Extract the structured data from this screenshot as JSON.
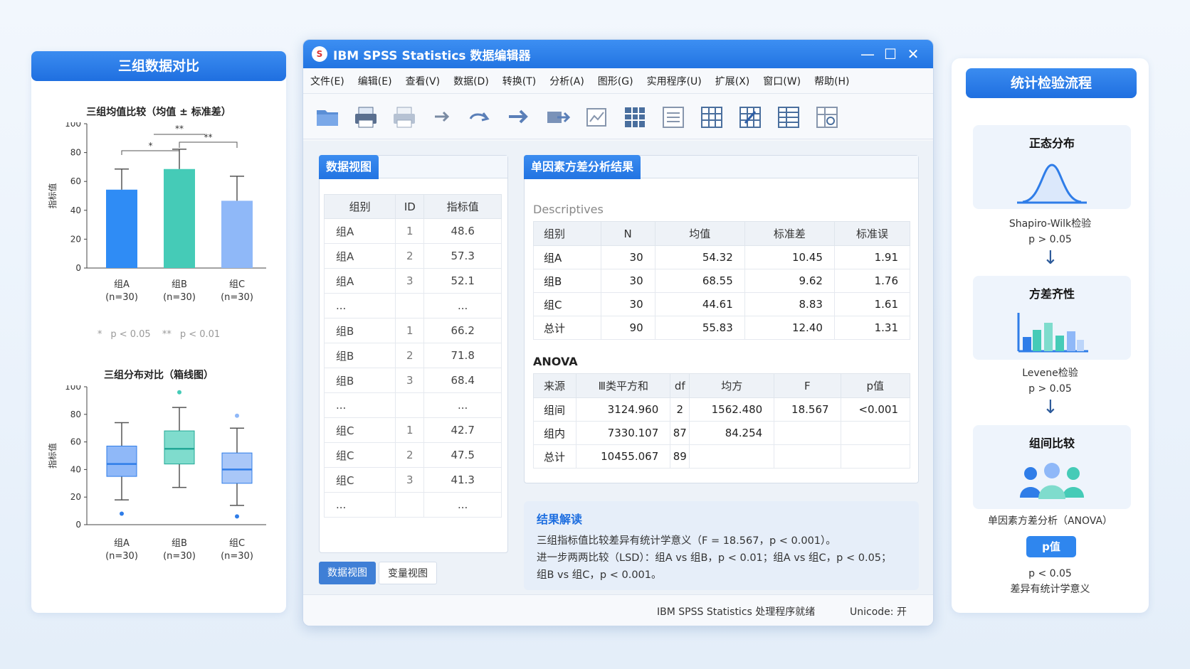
{
  "left_panel": {
    "header": "三组数据对比",
    "bar_chart_title": "三组均值比较（均值 ± 标准差）",
    "box_chart_title": "三组分布对比（箱线图）",
    "legend_single_star": "*",
    "legend_single_label": "p < 0.05",
    "legend_double_star": "**",
    "legend_double_label": "p < 0.01"
  },
  "chart_data": [
    {
      "type": "bar",
      "title": "三组均值比较（均值 ± 标准差）",
      "ylabel": "指标值",
      "ylim": [
        0,
        100
      ],
      "yticks": [
        0,
        20,
        40,
        60,
        80,
        100
      ],
      "categories": [
        "组A",
        "组B",
        "组C"
      ],
      "category_sub": [
        "(n=30)",
        "(n=30)",
        "(n=30)"
      ],
      "values": [
        54.3,
        68.6,
        46.6
      ],
      "errors": [
        14.3,
        13.7,
        17.0
      ],
      "colors": [
        "#2f8cf5",
        "#45cbb7",
        "#8fb8f8"
      ],
      "significance": [
        {
          "from": 0,
          "to": 1,
          "label": "*"
        },
        {
          "from": 1,
          "to": 2,
          "label": "**"
        },
        {
          "from": 1,
          "to": 1,
          "label": "**"
        }
      ]
    },
    {
      "type": "box",
      "title": "三组分布对比（箱线图）",
      "ylabel": "指标值",
      "ylim": [
        0,
        100
      ],
      "yticks": [
        0,
        20,
        40,
        60,
        80,
        100
      ],
      "categories": [
        "组A",
        "组B",
        "组C"
      ],
      "category_sub": [
        "(n=30)",
        "(n=30)",
        "(n=30)"
      ],
      "boxes": [
        {
          "min": 18,
          "q1": 35,
          "median": 44,
          "q3": 57,
          "max": 74,
          "outliers": [
            8
          ]
        },
        {
          "min": 27,
          "q1": 44,
          "median": 55,
          "q3": 68,
          "max": 85,
          "outliers": [
            96
          ]
        },
        {
          "min": 14,
          "q1": 30,
          "median": 40,
          "q3": 52,
          "max": 70,
          "outliers": [
            79,
            6
          ]
        }
      ],
      "colors": [
        "#8fb8f8",
        "#7fdccd",
        "#a9c7f8"
      ],
      "median_colors": [
        "#2f7de8",
        "#23a896",
        "#2f7de8"
      ]
    }
  ],
  "window": {
    "title": "IBM SPSS Statistics 数据编辑器",
    "icon_glyph": "S",
    "minimize": "—",
    "maximize": "☐",
    "close": "✕"
  },
  "menu": [
    "文件(E)",
    "编辑(E)",
    "查看(V)",
    "数据(D)",
    "转换(T)",
    "分析(A)",
    "图形(G)",
    "实用程序(U)",
    "扩展(X)",
    "窗口(W)",
    "帮助(H)"
  ],
  "toolbar_icons": [
    "open-folder-icon",
    "print-icon",
    "print-preview-icon",
    "arrow-right-icon",
    "redo-icon",
    "forward-icon",
    "export-icon",
    "chart-edit-icon",
    "grid-select-icon",
    "table-icon",
    "grid-icon",
    "grid-edit-icon",
    "table-alt-icon",
    "grid-settings-icon"
  ],
  "data_view": {
    "tab_label": "数据视图",
    "headers": [
      "组别",
      "ID",
      "指标值"
    ],
    "rows": [
      [
        "组A",
        "1",
        "48.6"
      ],
      [
        "组A",
        "2",
        "57.3"
      ],
      [
        "组A",
        "3",
        "52.1"
      ],
      [
        "...",
        "",
        "..."
      ],
      [
        "组B",
        "1",
        "66.2"
      ],
      [
        "组B",
        "2",
        "71.8"
      ],
      [
        "组B",
        "3",
        "68.4"
      ],
      [
        "...",
        "",
        "..."
      ],
      [
        "组C",
        "1",
        "42.7"
      ],
      [
        "组C",
        "2",
        "47.5"
      ],
      [
        "组C",
        "3",
        "41.3"
      ],
      [
        "...",
        "",
        "..."
      ]
    ]
  },
  "view_tabs": {
    "data": "数据视图",
    "variable": "变量视图"
  },
  "results": {
    "tab_label": "单因素方差分析结果",
    "descriptives_label": "Descriptives",
    "desc_headers": [
      "组别",
      "N",
      "均值",
      "标准差",
      "标准误"
    ],
    "desc_rows": [
      [
        "组A",
        "30",
        "54.32",
        "10.45",
        "1.91"
      ],
      [
        "组B",
        "30",
        "68.55",
        "9.62",
        "1.76"
      ],
      [
        "组C",
        "30",
        "44.61",
        "8.83",
        "1.61"
      ],
      [
        "总计",
        "90",
        "55.83",
        "12.40",
        "1.31"
      ]
    ],
    "anova_label": "ANOVA",
    "anova_headers": [
      "来源",
      "Ⅲ类平方和",
      "df",
      "均方",
      "F",
      "p值"
    ],
    "anova_rows": [
      [
        "组间",
        "3124.960",
        "2",
        "1562.480",
        "18.567",
        "<0.001"
      ],
      [
        "组内",
        "7330.107",
        "87",
        "84.254",
        "",
        ""
      ],
      [
        "总计",
        "10455.067",
        "89",
        "",
        "",
        ""
      ]
    ]
  },
  "interpretation": {
    "title": "结果解读",
    "line1": "三组指标值比较差异有统计学意义（F = 18.567，p < 0.001）。",
    "line2": "进一步两两比较（LSD）：组A vs 组B，p < 0.01；组A vs 组C，p < 0.05；",
    "line3": "组B vs 组C，p < 0.001。"
  },
  "status": {
    "ready": "IBM SPSS Statistics 处理程序就绪",
    "unicode": "Unicode: 开"
  },
  "right_panel": {
    "header": "统计检验流程",
    "step1_title": "正态分布",
    "step1_test": "Shapiro-Wilk检验",
    "step1_result": "p > 0.05",
    "step2_title": "方差齐性",
    "step2_test": "Levene检验",
    "step2_result": "p > 0.05",
    "step3_title": "组间比较",
    "step3_test": "单因素方差分析（ANOVA）",
    "pvalue_badge": "p值",
    "final_result": "p < 0.05",
    "final_text": "差异有统计学意义",
    "arrow": "↓"
  }
}
